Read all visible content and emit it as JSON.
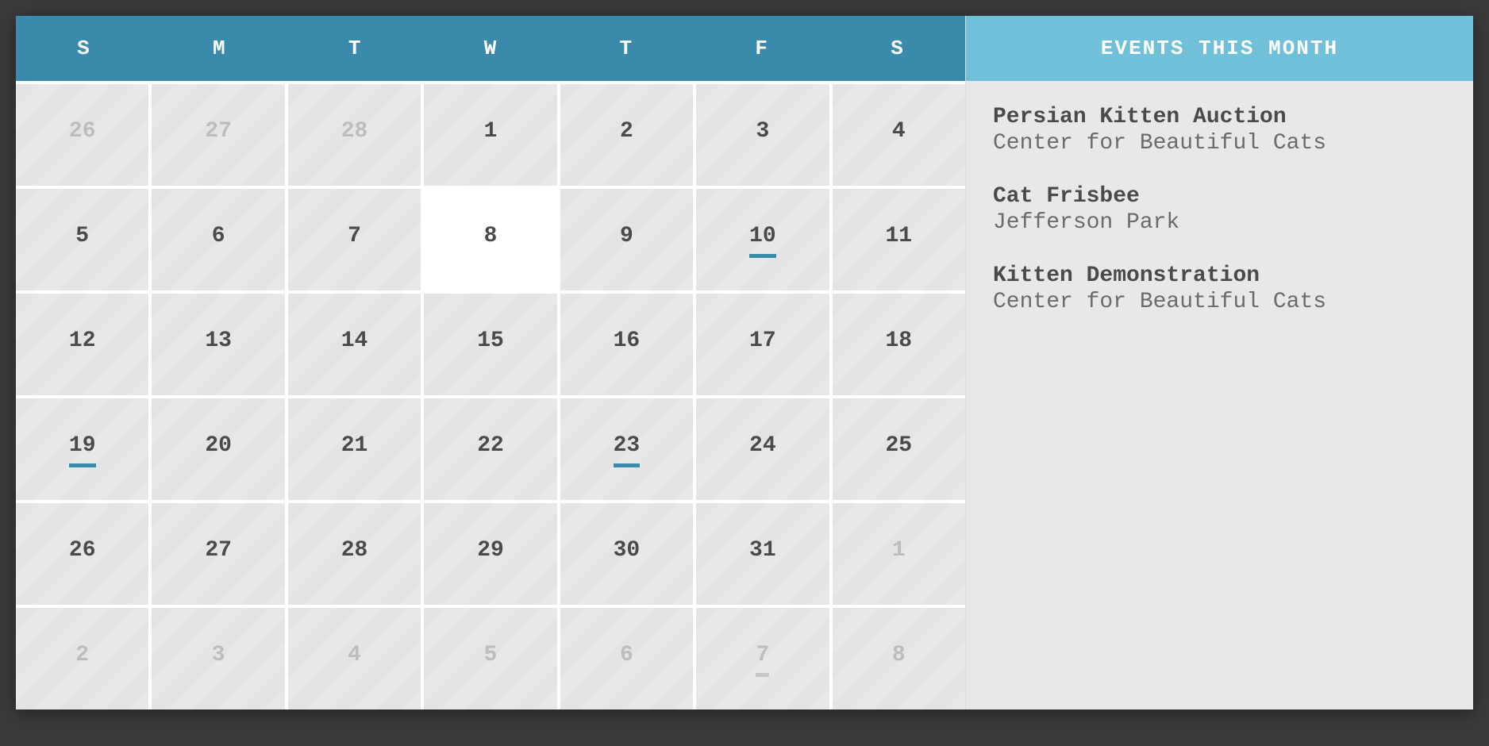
{
  "weekdays": [
    "S",
    "M",
    "T",
    "W",
    "T",
    "F",
    "S"
  ],
  "sidebar": {
    "header": "EVENTS THIS MONTH",
    "events": [
      {
        "title": "Persian Kitten Auction",
        "location": "Center for Beautiful Cats"
      },
      {
        "title": "Cat Frisbee",
        "location": "Jefferson Park"
      },
      {
        "title": "Kitten Demonstration",
        "location": "Center for Beautiful Cats"
      }
    ]
  },
  "days": [
    {
      "n": "26",
      "other": true,
      "today": false,
      "event": false
    },
    {
      "n": "27",
      "other": true,
      "today": false,
      "event": false
    },
    {
      "n": "28",
      "other": true,
      "today": false,
      "event": false
    },
    {
      "n": "1",
      "other": false,
      "today": false,
      "event": false
    },
    {
      "n": "2",
      "other": false,
      "today": false,
      "event": false
    },
    {
      "n": "3",
      "other": false,
      "today": false,
      "event": false
    },
    {
      "n": "4",
      "other": false,
      "today": false,
      "event": false
    },
    {
      "n": "5",
      "other": false,
      "today": false,
      "event": false
    },
    {
      "n": "6",
      "other": false,
      "today": false,
      "event": false
    },
    {
      "n": "7",
      "other": false,
      "today": false,
      "event": false
    },
    {
      "n": "8",
      "other": false,
      "today": true,
      "event": false
    },
    {
      "n": "9",
      "other": false,
      "today": false,
      "event": false
    },
    {
      "n": "10",
      "other": false,
      "today": false,
      "event": true
    },
    {
      "n": "11",
      "other": false,
      "today": false,
      "event": false
    },
    {
      "n": "12",
      "other": false,
      "today": false,
      "event": false
    },
    {
      "n": "13",
      "other": false,
      "today": false,
      "event": false
    },
    {
      "n": "14",
      "other": false,
      "today": false,
      "event": false
    },
    {
      "n": "15",
      "other": false,
      "today": false,
      "event": false
    },
    {
      "n": "16",
      "other": false,
      "today": false,
      "event": false
    },
    {
      "n": "17",
      "other": false,
      "today": false,
      "event": false
    },
    {
      "n": "18",
      "other": false,
      "today": false,
      "event": false
    },
    {
      "n": "19",
      "other": false,
      "today": false,
      "event": true
    },
    {
      "n": "20",
      "other": false,
      "today": false,
      "event": false
    },
    {
      "n": "21",
      "other": false,
      "today": false,
      "event": false
    },
    {
      "n": "22",
      "other": false,
      "today": false,
      "event": false
    },
    {
      "n": "23",
      "other": false,
      "today": false,
      "event": true
    },
    {
      "n": "24",
      "other": false,
      "today": false,
      "event": false
    },
    {
      "n": "25",
      "other": false,
      "today": false,
      "event": false
    },
    {
      "n": "26",
      "other": false,
      "today": false,
      "event": false
    },
    {
      "n": "27",
      "other": false,
      "today": false,
      "event": false
    },
    {
      "n": "28",
      "other": false,
      "today": false,
      "event": false
    },
    {
      "n": "29",
      "other": false,
      "today": false,
      "event": false
    },
    {
      "n": "30",
      "other": false,
      "today": false,
      "event": false
    },
    {
      "n": "31",
      "other": false,
      "today": false,
      "event": false
    },
    {
      "n": "1",
      "other": true,
      "today": false,
      "event": false
    },
    {
      "n": "2",
      "other": true,
      "today": false,
      "event": false
    },
    {
      "n": "3",
      "other": true,
      "today": false,
      "event": false
    },
    {
      "n": "4",
      "other": true,
      "today": false,
      "event": false
    },
    {
      "n": "5",
      "other": true,
      "today": false,
      "event": false
    },
    {
      "n": "6",
      "other": true,
      "today": false,
      "event": false
    },
    {
      "n": "7",
      "other": true,
      "today": false,
      "event": true
    },
    {
      "n": "8",
      "other": true,
      "today": false,
      "event": false
    }
  ]
}
